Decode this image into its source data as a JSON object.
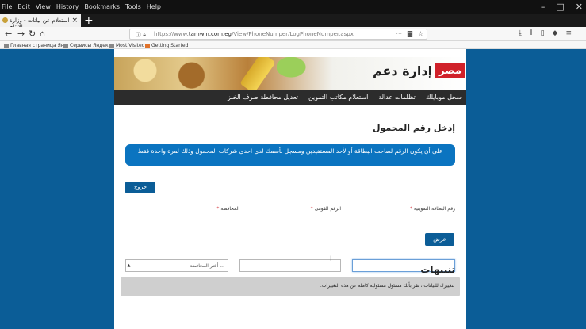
{
  "browser": {
    "menu": [
      "File",
      "Edit",
      "View",
      "History",
      "Bookmarks",
      "Tools",
      "Help"
    ],
    "window_controls": [
      "–",
      "□",
      "✕"
    ],
    "tab": {
      "title": "استعلام عن بيانات - وزارة الانتاج",
      "close": "×"
    },
    "new_tab": "+",
    "url": {
      "prefix": "https://www.",
      "domain": "tamwin.com.eg",
      "path": "/View/PhoneNumper/LogPhoneNumper.aspx"
    },
    "bookmarks": [
      "Главная страница Ян...",
      "Сервисы Яндекса",
      "Most Visited",
      "Getting Started"
    ]
  },
  "site": {
    "brand_box": "مصر",
    "brand_text": "إدارة دعم",
    "nav": [
      "سجل موبايلك",
      "تظلمات عدالة",
      "استعلام مكاتب التموين",
      "تعديل محافظة صرف الخبز"
    ],
    "page_title": "إدخل رقم المحمول",
    "info": "على أن يكون الرقم لصاحب البطاقة أو لأحد المستفيدين ومسجل بأسمك لدى احدى شركات المحمول وذلك لمرة واحدة فقط",
    "exit_button": "خروج",
    "fields": {
      "card_label": "رقم البطاقة التموينية",
      "national_label": "الرقم القومى",
      "gov_label": "المحافظة",
      "required": "*",
      "gov_placeholder": "... أختر المحافظة"
    },
    "show_button": "عرض",
    "notes_title": "تنبيهات",
    "notes_text": "بتغييرك للبيانات ، تقر بأنك مسئول مسئولية كاملة عن هذه التغييرات."
  }
}
